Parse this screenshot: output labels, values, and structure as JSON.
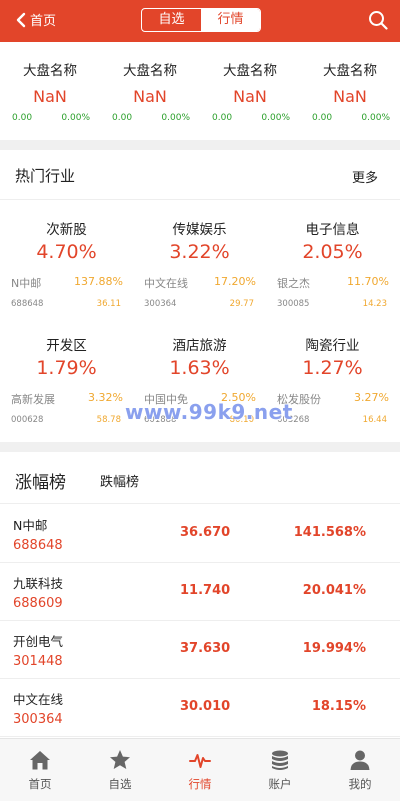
{
  "header": {
    "back_label": "首页",
    "segments": [
      "自选",
      "行情"
    ],
    "active_segment": "行情"
  },
  "indices": [
    {
      "name": "大盘名称",
      "value": "NaN",
      "change": "0.00",
      "percent": "0.00%"
    },
    {
      "name": "大盘名称",
      "value": "NaN",
      "change": "0.00",
      "percent": "0.00%"
    },
    {
      "name": "大盘名称",
      "value": "NaN",
      "change": "0.00",
      "percent": "0.00%"
    },
    {
      "name": "大盘名称",
      "value": "NaN",
      "change": "0.00",
      "percent": "0.00%"
    }
  ],
  "hot_sectors": {
    "title": "热门行业",
    "more_label": "更多",
    "items": [
      {
        "name": "次新股",
        "percent": "4.70%",
        "leader_name": "N中邮",
        "leader_percent": "137.88%",
        "leader_code": "688648",
        "leader_price": "36.11"
      },
      {
        "name": "传媒娱乐",
        "percent": "3.22%",
        "leader_name": "中文在线",
        "leader_percent": "17.20%",
        "leader_code": "300364",
        "leader_price": "29.77"
      },
      {
        "name": "电子信息",
        "percent": "2.05%",
        "leader_name": "银之杰",
        "leader_percent": "11.70%",
        "leader_code": "300085",
        "leader_price": "14.23"
      },
      {
        "name": "开发区",
        "percent": "1.79%",
        "leader_name": "高新发展",
        "leader_percent": "3.32%",
        "leader_code": "000628",
        "leader_price": "58.78"
      },
      {
        "name": "酒店旅游",
        "percent": "1.63%",
        "leader_name": "中国中免",
        "leader_percent": "2.50%",
        "leader_code": "601888",
        "leader_price": "80.10"
      },
      {
        "name": "陶瓷行业",
        "percent": "1.27%",
        "leader_name": "松发股份",
        "leader_percent": "3.27%",
        "leader_code": "603268",
        "leader_price": "16.44"
      }
    ]
  },
  "watermark": "www.99k9.net",
  "ranking": {
    "tabs": [
      "涨幅榜",
      "跌幅榜"
    ],
    "rows": [
      {
        "name": "N中邮",
        "code": "688648",
        "price": "36.670",
        "percent": "141.568%"
      },
      {
        "name": "九联科技",
        "code": "688609",
        "price": "11.740",
        "percent": "20.041%"
      },
      {
        "name": "开创电气",
        "code": "301448",
        "price": "37.630",
        "percent": "19.994%"
      },
      {
        "name": "中文在线",
        "code": "300364",
        "price": "30.010",
        "percent": "18.15%"
      }
    ]
  },
  "tabbar": {
    "items": [
      {
        "label": "首页",
        "icon": "home-icon"
      },
      {
        "label": "自选",
        "icon": "star-icon"
      },
      {
        "label": "行情",
        "icon": "pulse-icon"
      },
      {
        "label": "账户",
        "icon": "coins-icon"
      },
      {
        "label": "我的",
        "icon": "user-icon"
      }
    ],
    "active": "行情"
  },
  "colors": {
    "brand": "#e2452a",
    "positive_green": "#2ca02c",
    "leader_orange": "#f0a830"
  }
}
